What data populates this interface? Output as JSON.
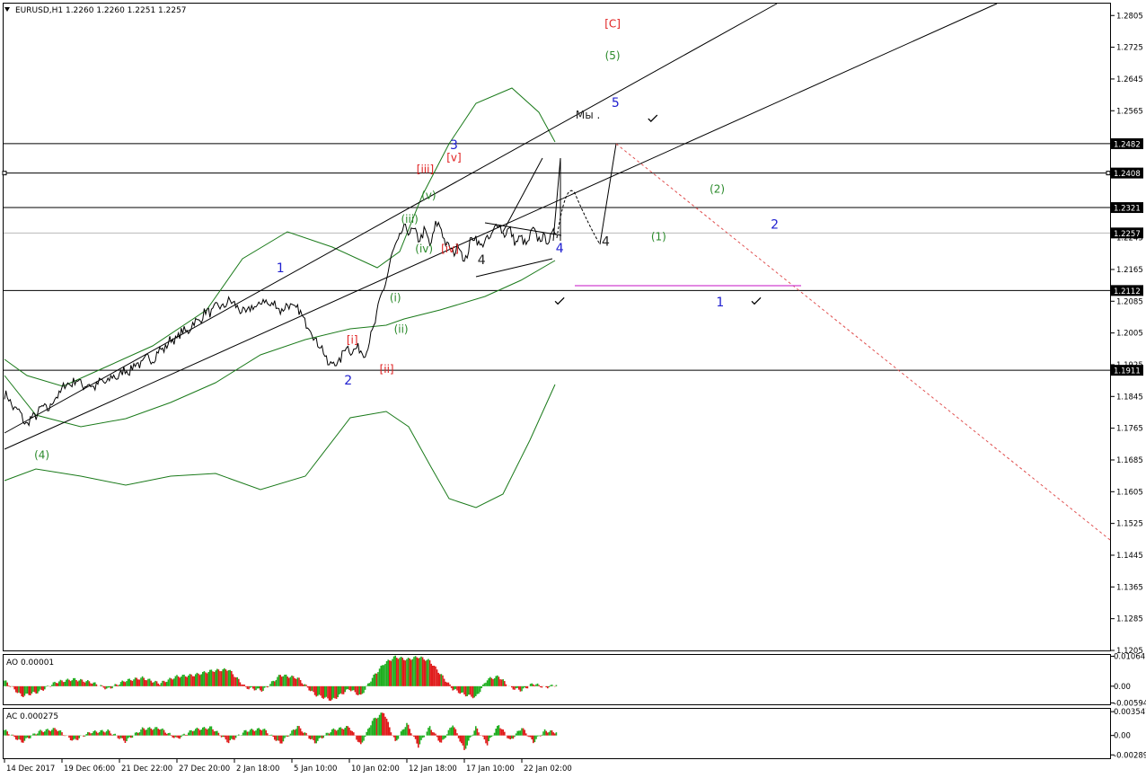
{
  "header": {
    "title": "EURUSD,H1  1.2260 1.2260 1.2251 1.2257",
    "menu_icon": "triangle-down-icon"
  },
  "chart_data": [
    {
      "panel": "main",
      "type": "line",
      "symbol": "EURUSD",
      "timeframe": "H1",
      "ohlc": {
        "open": 1.226,
        "high": 1.226,
        "low": 1.2251,
        "close": 1.2257
      },
      "ylim": [
        1.1205,
        1.2835
      ],
      "y_ticks": [
        1.2805,
        1.2725,
        1.2645,
        1.2565,
        1.2485,
        1.2405,
        1.2325,
        1.2245,
        1.2165,
        1.2085,
        1.2005,
        1.1925,
        1.1845,
        1.1765,
        1.1685,
        1.1605,
        1.1525,
        1.1445,
        1.1365,
        1.1285,
        1.1205
      ],
      "x_ticks": [
        "14 Dec 2017",
        "19 Dec 06:00",
        "21 Dec 22:00",
        "27 Dec 20:00",
        "2 Jan 18:00",
        "5 Jan 10:00",
        "10 Jan 02:00",
        "12 Jan 18:00",
        "17 Jan 10:00",
        "22 Jan 02:00"
      ],
      "x_tick_index": [
        0,
        10,
        20,
        30,
        40,
        50,
        60,
        70,
        80,
        90
      ],
      "price_series": {
        "name": "",
        "x": [
          0,
          4,
          6,
          8,
          10,
          12,
          15,
          18,
          20,
          23,
          26,
          29,
          32,
          35,
          38,
          40,
          41,
          43,
          45,
          47,
          48,
          50,
          52,
          53.5,
          55,
          56.5,
          58,
          59.5,
          61,
          62,
          63,
          64,
          65,
          66,
          67,
          68,
          69,
          70,
          71,
          72,
          73,
          74,
          75,
          76,
          77,
          78,
          79,
          80,
          81,
          82,
          83,
          84,
          85,
          86,
          87,
          88,
          89,
          90,
          91,
          92,
          93,
          94,
          95,
          96
        ],
        "values": [
          1.185,
          1.1775,
          1.181,
          1.182,
          1.1865,
          1.1885,
          1.187,
          1.1885,
          1.19,
          1.1925,
          1.1945,
          1.1985,
          1.2015,
          1.2055,
          1.2075,
          1.2085,
          1.2055,
          1.2065,
          1.2085,
          1.2075,
          1.2065,
          1.2075,
          1.2045,
          1.2005,
          1.197,
          1.1925,
          1.193,
          1.197,
          1.196,
          1.1965,
          1.1955,
          1.201,
          1.2065,
          1.212,
          1.2175,
          1.2225,
          1.2255,
          1.2268,
          1.2262,
          1.2242,
          1.2262,
          1.2225,
          1.2278,
          1.2268,
          1.2225,
          1.2205,
          1.2232,
          1.218,
          1.2235,
          1.2245,
          1.2225,
          1.2238,
          1.226,
          1.2282,
          1.2255,
          1.2262,
          1.2235,
          1.224,
          1.2232,
          1.2262,
          1.2245,
          1.2238,
          1.2248,
          1.2257
        ]
      },
      "horizontal_levels": [
        {
          "value": 1.2482,
          "label": "1.2482"
        },
        {
          "value": 1.2408,
          "label": "1.2408"
        },
        {
          "value": 1.2321,
          "label": "1.2321"
        },
        {
          "value": 1.2257,
          "label": "1.2257",
          "current": true
        },
        {
          "value": 1.2112,
          "label": "1.2112"
        },
        {
          "value": 1.1911,
          "label": "1.1911"
        }
      ],
      "wave_labels": [
        {
          "text": "[C]",
          "x": 105.8,
          "y": 1.2775,
          "color": "#e02020"
        },
        {
          "text": "(5)",
          "x": 105.8,
          "y": 1.2695,
          "color": "#2a8a2a"
        },
        {
          "text": "5",
          "x": 106.3,
          "y": 1.2575,
          "color": "#2020d0"
        },
        {
          "text": "Мы .",
          "x": 101.5,
          "y": 1.2545,
          "color": "#222222"
        },
        {
          "text": "3",
          "x": 78.2,
          "y": 1.2468,
          "color": "#2020d0"
        },
        {
          "text": "[v]",
          "x": 78.2,
          "y": 1.2438,
          "color": "#e02020"
        },
        {
          "text": "[iii]",
          "x": 73.2,
          "y": 1.2408,
          "color": "#e02020"
        },
        {
          "text": "(v)",
          "x": 73.8,
          "y": 1.2343,
          "color": "#2a8a2a"
        },
        {
          "text": "(iii)",
          "x": 70.5,
          "y": 1.2283,
          "color": "#2a8a2a"
        },
        {
          "text": "(iv)",
          "x": 73.0,
          "y": 1.2208,
          "color": "#2a8a2a"
        },
        {
          "text": "[iv]",
          "x": 77.5,
          "y": 1.2208,
          "color": "#e02020"
        },
        {
          "text": "4",
          "x": 83.0,
          "y": 1.2178,
          "color": "#222222"
        },
        {
          "text": "4",
          "x": 96.6,
          "y": 1.2208,
          "color": "#2020d0"
        },
        {
          "text": "4",
          "x": 104.6,
          "y": 1.2225,
          "color": "#222222"
        },
        {
          "text": "(2)",
          "x": 124.0,
          "y": 1.2358,
          "color": "#2a8a2a"
        },
        {
          "text": "2",
          "x": 134.0,
          "y": 1.2268,
          "color": "#2020d0"
        },
        {
          "text": "(1)",
          "x": 113.8,
          "y": 1.2238,
          "color": "#2a8a2a"
        },
        {
          "text": "1",
          "x": 124.5,
          "y": 1.2072,
          "color": "#2020d0"
        },
        {
          "text": "1",
          "x": 48.0,
          "y": 1.2158,
          "color": "#2020d0"
        },
        {
          "text": "(i)",
          "x": 68.0,
          "y": 1.2085,
          "color": "#2a8a2a"
        },
        {
          "text": "[i]",
          "x": 60.5,
          "y": 1.1978,
          "color": "#e02020"
        },
        {
          "text": "(ii)",
          "x": 69.0,
          "y": 1.2005,
          "color": "#2a8a2a"
        },
        {
          "text": "2",
          "x": 59.8,
          "y": 1.1875,
          "color": "#2020d0"
        },
        {
          "text": "[ii]",
          "x": 66.5,
          "y": 1.1905,
          "color": "#e02020"
        },
        {
          "text": "(4)",
          "x": 6.5,
          "y": 1.1688,
          "color": "#2a8a2a"
        }
      ],
      "check_marks": [
        {
          "x": 112.0,
          "y": 1.2545
        },
        {
          "x": 95.8,
          "y": 1.2085
        },
        {
          "x": 130.0,
          "y": 1.2085
        }
      ]
    },
    {
      "panel": "ao",
      "type": "bar",
      "title": "AO 0.00001",
      "ylim": [
        -0.00645,
        0.01114
      ],
      "y_ticks": [
        0.01064,
        0.0,
        -0.00594
      ],
      "y_tick_labels": [
        "0.01064",
        "0.00",
        "-0.00594"
      ],
      "x": [
        0,
        3,
        6,
        9,
        12,
        15,
        18,
        21,
        24,
        27,
        30,
        33,
        36,
        39,
        42,
        45,
        48,
        51,
        54,
        57,
        60,
        62,
        64,
        66,
        68,
        70,
        72,
        74,
        76,
        78,
        80,
        82,
        84,
        86,
        88,
        90,
        92,
        94,
        96
      ],
      "values": [
        0.002,
        -0.0035,
        -0.002,
        0.0015,
        0.0025,
        0.0015,
        -0.001,
        0.002,
        0.003,
        0.001,
        0.0035,
        0.004,
        0.0055,
        0.006,
        -0.0005,
        -0.0015,
        0.004,
        0.003,
        -0.003,
        -0.005,
        -0.001,
        -0.0035,
        0.003,
        0.008,
        0.0105,
        0.0095,
        0.0105,
        0.009,
        0.004,
        -0.001,
        -0.003,
        -0.004,
        0.0025,
        0.0035,
        -0.0005,
        -0.0015,
        0.001,
        -0.0005,
        0.0005
      ]
    },
    {
      "panel": "ac",
      "type": "bar",
      "title": "AC 0.000275",
      "ylim": [
        -0.00339,
        0.00397
      ],
      "y_ticks": [
        0.003547,
        0.0,
        -0.00289
      ],
      "y_tick_labels": [
        "0.003547",
        "0.00",
        "-0.00289"
      ],
      "x": [
        0,
        3,
        6,
        9,
        12,
        15,
        18,
        21,
        24,
        27,
        30,
        33,
        36,
        39,
        42,
        45,
        48,
        51,
        54,
        57,
        60,
        62,
        64,
        66,
        68,
        70,
        72,
        74,
        76,
        78,
        80,
        82,
        84,
        86,
        88,
        90,
        92,
        94,
        96
      ],
      "values": [
        0.0008,
        -0.001,
        0.0006,
        0.001,
        -0.0008,
        0.0005,
        0.0007,
        -0.0009,
        0.001,
        0.0011,
        -0.0005,
        0.0009,
        0.0012,
        -0.001,
        0.0007,
        0.001,
        -0.0012,
        0.0014,
        -0.0011,
        0.0008,
        0.0013,
        -0.0015,
        0.0022,
        0.0035,
        -0.001,
        0.0018,
        -0.0016,
        0.0013,
        -0.0012,
        0.0017,
        -0.0022,
        0.0012,
        -0.0013,
        0.0016,
        -0.0008,
        0.0012,
        -0.001,
        0.0007,
        0.0005
      ]
    }
  ],
  "colors": {
    "price": "#000000",
    "bollinger": "#1a7a1a",
    "channel": "#000000",
    "projection_red": "#e05050",
    "magenta_line": "#d040d0",
    "current_level": "#b8b8b8",
    "bar_up": "#1fae1f",
    "bar_down": "#e01b1b",
    "axis_text": "#000000",
    "frame": "#000000",
    "label_box": "#000000"
  }
}
